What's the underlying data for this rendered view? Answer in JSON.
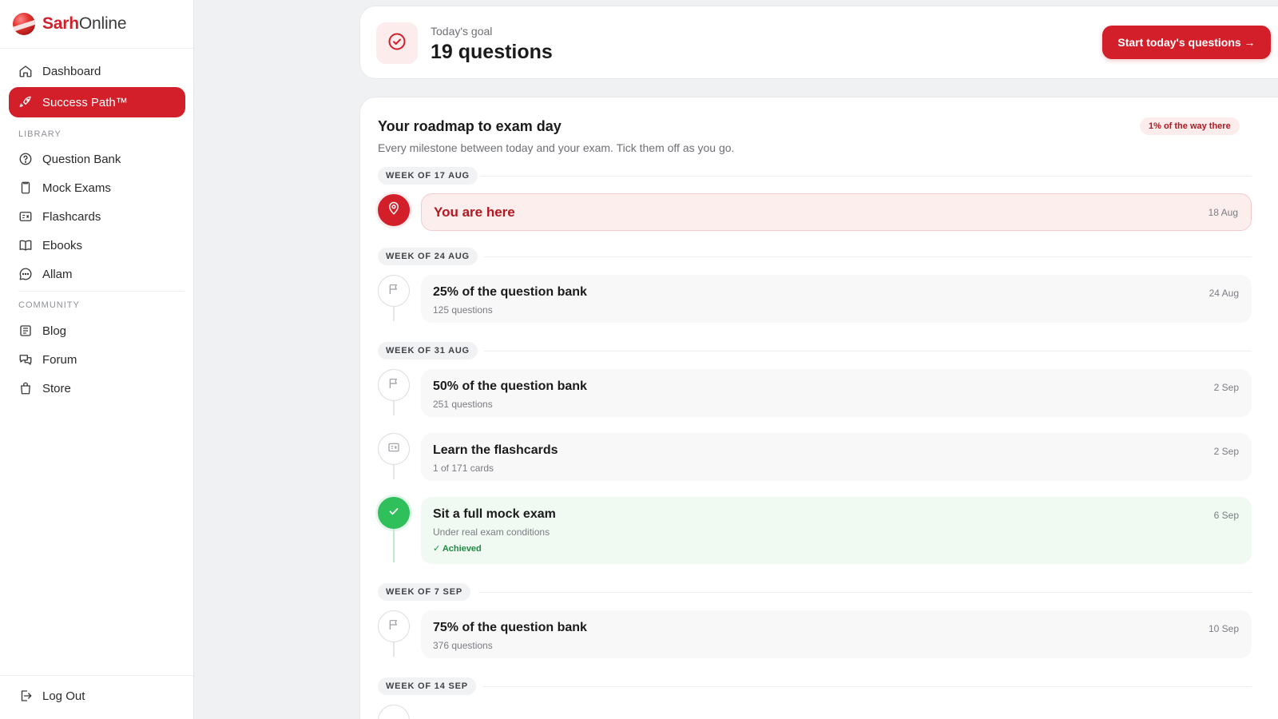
{
  "brand": {
    "name_bold": "Sarh",
    "name_light": "Online"
  },
  "sidebar": {
    "primary": [
      {
        "label": "Dashboard",
        "icon": "home-icon"
      },
      {
        "label": "Success Path™",
        "icon": "rocket-icon",
        "active": true
      }
    ],
    "library_heading": "LIBRARY",
    "library": [
      {
        "label": "Question Bank",
        "icon": "question-circle-icon"
      },
      {
        "label": "Mock Exams",
        "icon": "exam-sheet-icon"
      },
      {
        "label": "Flashcards",
        "icon": "flashcard-icon"
      },
      {
        "label": "Ebooks",
        "icon": "book-icon"
      },
      {
        "label": "Allam",
        "icon": "chat-bubble-icon"
      }
    ],
    "community_heading": "COMMUNITY",
    "community": [
      {
        "label": "Blog",
        "icon": "newspaper-icon"
      },
      {
        "label": "Forum",
        "icon": "forum-icon"
      },
      {
        "label": "Store",
        "icon": "shopping-bag-icon"
      }
    ],
    "logout": {
      "label": "Log Out",
      "icon": "logout-icon"
    }
  },
  "goal": {
    "label": "Today's goal",
    "value": "19 questions",
    "button": "Start today's questions →"
  },
  "roadmap": {
    "title": "Your roadmap to exam day",
    "subtitle": "Every milestone between today and your exam. Tick them off as you go.",
    "progress_badge": "1% of the way there",
    "weeks": [
      {
        "label": "WEEK OF 17 AUG"
      },
      {
        "label": "WEEK OF 24 AUG"
      },
      {
        "label": "WEEK OF 31 AUG"
      },
      {
        "label": "WEEK OF 7 SEP"
      },
      {
        "label": "WEEK OF 14 SEP"
      }
    ],
    "milestones": [
      {
        "title": "You are here",
        "date": "18 Aug",
        "state": "current",
        "icon": "location-pin-icon"
      },
      {
        "title": "25% of the question bank",
        "meta": "125 questions",
        "date": "24 Aug",
        "state": "pending",
        "icon": "flag-icon"
      },
      {
        "title": "50% of the question bank",
        "meta": "251 questions",
        "date": "2 Sep",
        "state": "pending",
        "icon": "flag-icon"
      },
      {
        "title": "Learn the flashcards",
        "meta": "1 of 171 cards",
        "date": "2 Sep",
        "state": "pending",
        "icon": "flashcard-icon"
      },
      {
        "title": "Sit a full mock exam",
        "meta": "Under real exam conditions",
        "status": "✓ Achieved",
        "date": "6 Sep",
        "state": "done",
        "icon": "check-icon"
      },
      {
        "title": "75% of the question bank",
        "meta": "376 questions",
        "date": "10 Sep",
        "state": "pending",
        "icon": "flag-icon"
      }
    ]
  },
  "colors": {
    "brand_red": "#d31f2a",
    "success_green": "#2fbf5b",
    "background": "#f0f1f3"
  }
}
